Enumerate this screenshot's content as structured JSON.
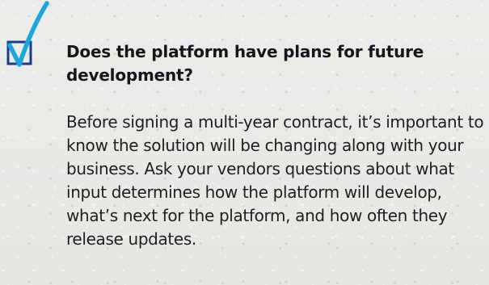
{
  "colors": {
    "accent": "#1ba6dc",
    "checkbox_border": "#1a3f8a",
    "text": "#1d1f24",
    "background": "#eaeae8"
  },
  "icon": "checked-checkbox-icon",
  "faq": {
    "question": "Does the platform have plans for future development?",
    "answer": "Before signing a multi-year contract, it’s important to know the solution will be changing along with your business. Ask your vendors questions about what input determines how the platform will develop, what’s next for the platform, and how often they release updates."
  }
}
